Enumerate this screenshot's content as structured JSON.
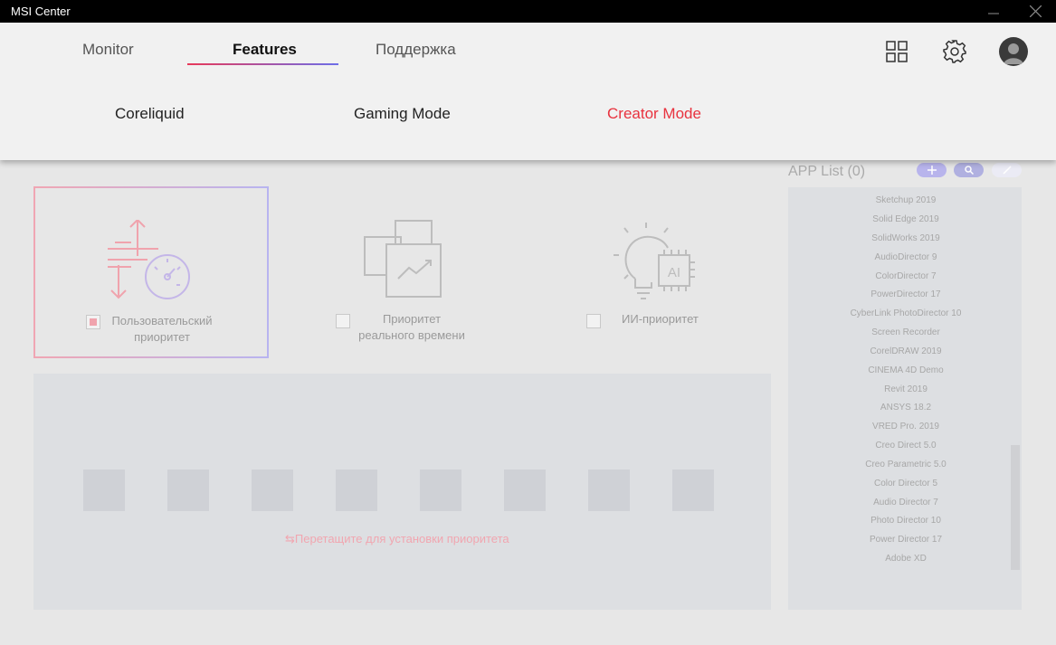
{
  "window": {
    "title": "MSI Center"
  },
  "nav": {
    "tabs": [
      {
        "label": "Monitor"
      },
      {
        "label": "Features"
      },
      {
        "label": "Поддержка"
      }
    ],
    "subtabs": [
      {
        "label": "Coreliquid"
      },
      {
        "label": "Gaming Mode"
      },
      {
        "label": "Creator Mode"
      }
    ]
  },
  "modes": [
    {
      "label": "Пользовательский приоритет",
      "checked": true
    },
    {
      "label": "Приоритет реального времени",
      "checked": false
    },
    {
      "label": "ИИ-приоритет",
      "checked": false
    }
  ],
  "drop_area": {
    "hint": "Перетащите для установки приоритета",
    "slot_count": 8
  },
  "app_list": {
    "title": "APP List (0)",
    "items": [
      "Sketchup 2019",
      "Solid Edge 2019",
      "SolidWorks 2019",
      "AudioDirector 9",
      "ColorDirector 7",
      "PowerDirector 17",
      "CyberLink PhotoDirector 10",
      "Screen Recorder",
      "CorelDRAW 2019",
      "CINEMA 4D Demo",
      "Revit 2019",
      "ANSYS 18.2",
      "VRED Pro. 2019",
      "Creo Direct 5.0",
      "Creo Parametric 5.0",
      "Color Director 5",
      "Audio Director 7",
      "Photo Director 10",
      "Power Director 17",
      "Adobe XD"
    ]
  },
  "colors": {
    "accent_red": "#e8323e",
    "accent_purple": "#6d6ee8",
    "pink": "#f0a3ad"
  },
  "icons": {
    "tiles": "grid-icon",
    "settings": "gear-icon",
    "profile": "avatar-icon",
    "add": "plus-icon",
    "search": "search-icon",
    "edit": "pencil-icon"
  }
}
